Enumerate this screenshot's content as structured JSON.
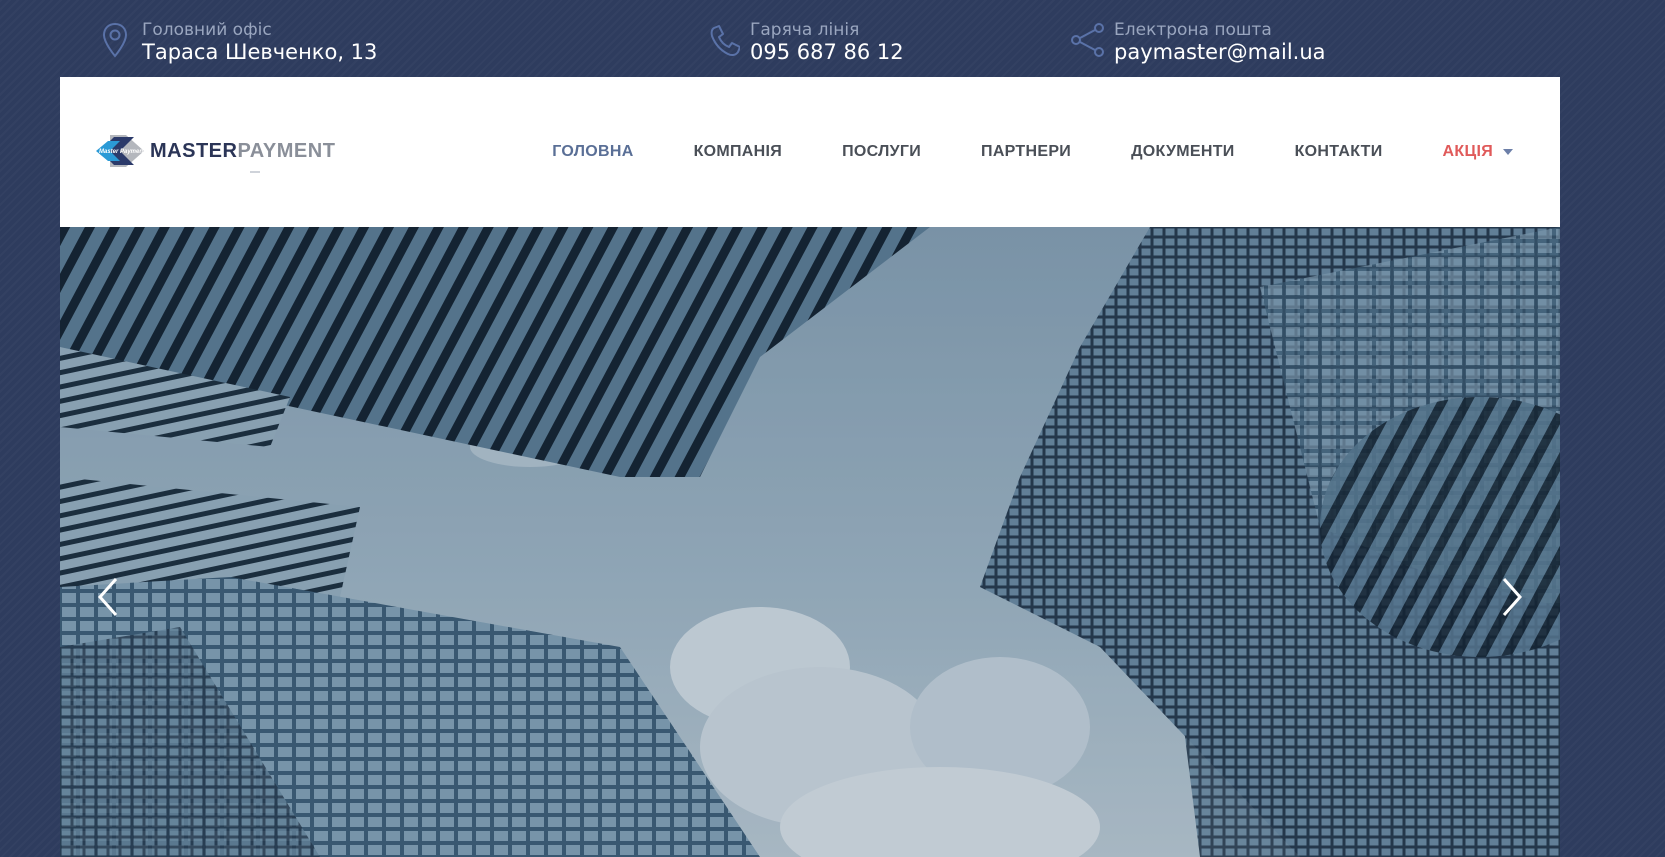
{
  "topbar": {
    "office": {
      "label": "Головний офіс",
      "value": "Тараса Шевченко, 13",
      "icon": "map-pin-icon"
    },
    "phone": {
      "label": "Гаряча лінія",
      "value": "095 687 86 12",
      "icon": "phone-icon"
    },
    "email": {
      "label": "Електрона пошта",
      "value": "paymaster@mail.ua",
      "icon": "share-icon"
    }
  },
  "logo": {
    "badge_text": "Master Payment",
    "word_primary": "MASTER",
    "word_secondary": "PAYMENT"
  },
  "nav": {
    "items": [
      {
        "label": "ГОЛОВНА",
        "active": true
      },
      {
        "label": "КОМПАНІЯ"
      },
      {
        "label": "ПОСЛУГИ"
      },
      {
        "label": "ПАРТНЕРИ"
      },
      {
        "label": "ДОКУМЕНТИ"
      },
      {
        "label": "КОНТАКТИ"
      },
      {
        "label": "АКЦІЯ",
        "has_dropdown": true
      }
    ]
  },
  "hero": {
    "prev_icon": "chevron-left-icon",
    "next_icon": "chevron-right-icon"
  },
  "colors": {
    "page_bg": "#2e3c5e",
    "nav_active": "#5a6f96",
    "nav_promo": "#e05a5a",
    "nav_default": "#4a4f57"
  }
}
